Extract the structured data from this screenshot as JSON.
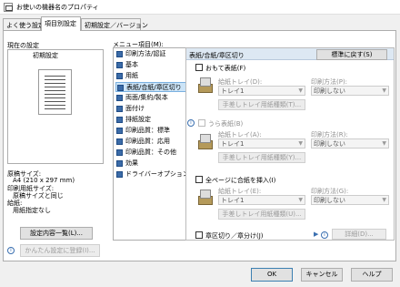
{
  "window": {
    "title": "お使いの機器名のプロパティ"
  },
  "tabs": [
    {
      "label": "よく使う設定"
    },
    {
      "label": "項目別設定"
    },
    {
      "label": "初期設定／バージョン"
    }
  ],
  "left": {
    "current_settings_label": "現在の設定",
    "current_settings_value": "初期設定",
    "info": {
      "l1": "原稿サイズ:",
      "l2": "A4 (210 x 297 mm)",
      "l3": "印刷用紙サイズ:",
      "l4": "原稿サイズと同じ",
      "l5": "給紙:",
      "l6": "用紙指定なし"
    },
    "settings_list_button": "設定内容一覧(L)...",
    "register_button": "かんたん設定に登録(I)..."
  },
  "menu": {
    "label": "メニュー項目(M):",
    "items": [
      {
        "label": "印刷方法/認証"
      },
      {
        "label": "基本"
      },
      {
        "label": "用紙"
      },
      {
        "label": "表紙/合紙/章区切り"
      },
      {
        "label": "両面/集約/製本"
      },
      {
        "label": "面付け"
      },
      {
        "label": "排紙設定"
      },
      {
        "label": "印刷品質：標準"
      },
      {
        "label": "印刷品質：応用"
      },
      {
        "label": "印刷品質：その他"
      },
      {
        "label": "効果"
      },
      {
        "label": "ドライバーオプション"
      }
    ]
  },
  "right": {
    "header": "表紙/合紙/章区切り",
    "restore_button": "標準に戻す(S)",
    "front_cover": {
      "label": "おもて表紙(F)",
      "tray_label": "給紙トレイ(D):",
      "tray_value": "トレイ1",
      "print_label": "印刷方法(P):",
      "print_value": "印刷しない",
      "paper_type_button": "手差しトレイ用紙種類(T)..."
    },
    "back_cover": {
      "label": "うら表紙(B)",
      "tray_label": "給紙トレイ(A):",
      "tray_value": "トレイ1",
      "print_label": "印刷方法(R):",
      "print_value": "印刷しない",
      "paper_type_button": "手差しトレイ用紙種類(Y)..."
    },
    "insert": {
      "label": "全ページに合紙を挿入(I)",
      "tray_label": "給紙トレイ(E):",
      "tray_value": "トレイ1",
      "print_label": "印刷方法(G):",
      "print_value": "印刷しない",
      "paper_type_button": "手差しトレイ用紙種類(U)..."
    },
    "chapter": {
      "label": "章区切り／章分け(J)",
      "details_button": "詳細(D)..."
    }
  },
  "footer": {
    "ok": "OK",
    "cancel": "キャンセル",
    "help": "ヘルプ"
  }
}
